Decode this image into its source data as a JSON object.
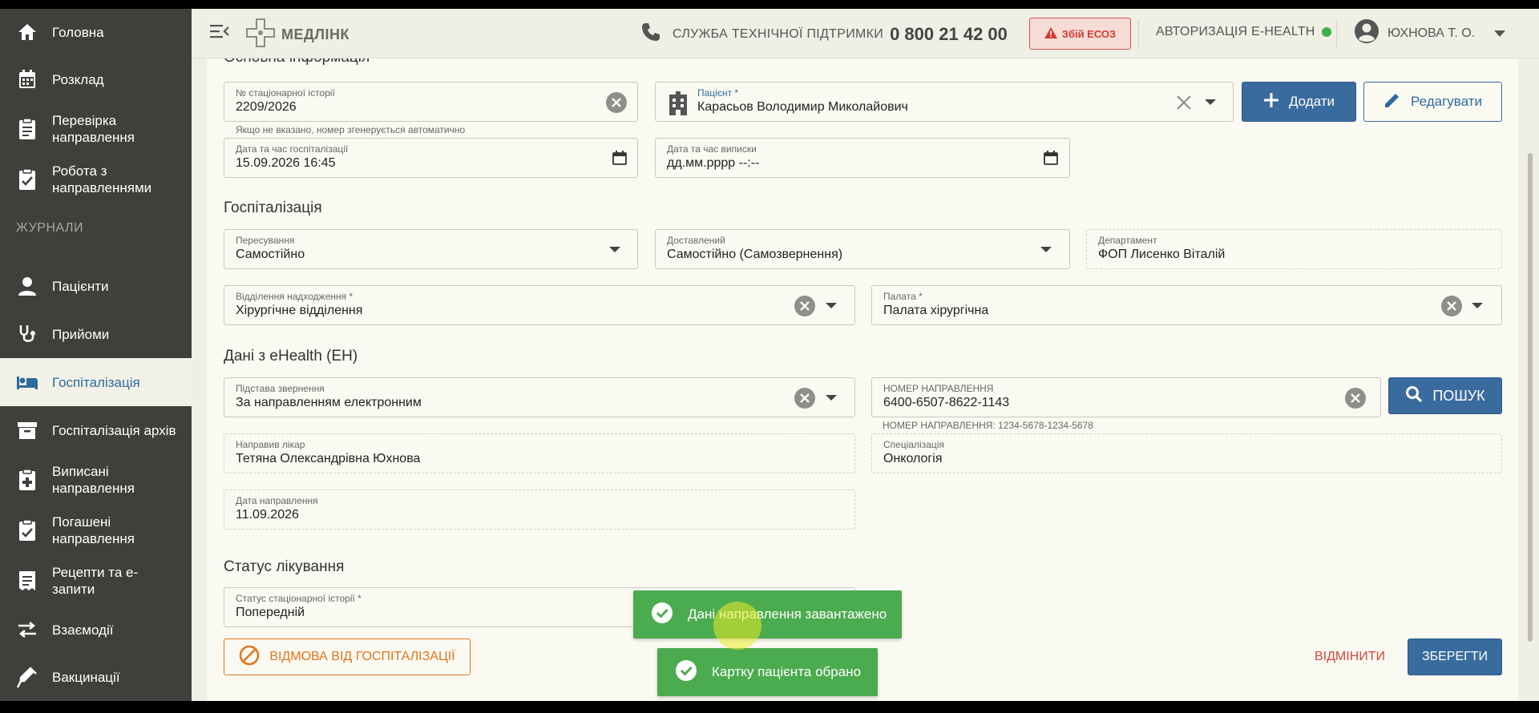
{
  "sidebar": {
    "items": [
      {
        "label": "Головна"
      },
      {
        "label": "Розклад"
      },
      {
        "label": "Перевірка\nнаправлення"
      },
      {
        "label": "Робота з\nнаправленнями"
      },
      {
        "label": "Пацієнти"
      },
      {
        "label": "Прийоми"
      },
      {
        "label": "Госпіталізація"
      },
      {
        "label": "Госпіталізація архів"
      },
      {
        "label": "Виписані\nнаправлення"
      },
      {
        "label": "Погашені\nнаправлення"
      },
      {
        "label": "Рецепти та е-\nзапити"
      },
      {
        "label": "Взаємодії"
      },
      {
        "label": "Вакцинації"
      }
    ],
    "section_label": "ЖУРНАЛИ"
  },
  "header": {
    "logo": "МЕДЛІНК",
    "support_label": "СЛУЖБА ТЕХНІЧНОЇ ПІДТРИМКИ",
    "support_phone": "0 800 21 42 00",
    "esoz_label": "Збій ЕСОЗ",
    "auth_label": "АВТОРИЗАЦІЯ E-HEALTH",
    "user_name": "ЮХНОВА Т. О."
  },
  "form": {
    "basic_title": "Основна інформація",
    "history_no": {
      "label": "№ стаціонарної історії",
      "value": "2209/2026",
      "hint": "Якщо не вказано, номер згенерується автоматично"
    },
    "patient": {
      "label": "Пацієнт *",
      "value": "Карасьов Володимир Миколайович"
    },
    "add_label": "Додати",
    "edit_label": "Редагувати",
    "admit_date": {
      "label": "Дата та час госпіталізації",
      "value": "15.09.2026 16:45"
    },
    "discharge_date": {
      "label": "Дата та час виписки",
      "value": "дд.мм.рррр --:--"
    },
    "hosp_title": "Госпіталізація",
    "transport": {
      "label": "Пересування",
      "value": "Самостійно"
    },
    "delivered": {
      "label": "Доставлений",
      "value": "Самостійно (Самозвернення)"
    },
    "department": {
      "label": "Департамент",
      "value": "ФОП Лисенко Віталій"
    },
    "ward_dept": {
      "label": "Відділення надходження *",
      "value": "Хірургічне відділення"
    },
    "ward": {
      "label": "Палата *",
      "value": "Палата хірургічна"
    },
    "eh_title": "Дані з eHealth (ЕН)",
    "reason": {
      "label": "Підстава звернення",
      "value": "За направленням електронним"
    },
    "referral_no": {
      "label": "НОМЕР НАПРАВЛЕННЯ",
      "value": "6400-6507-8622-1143",
      "hint": "НОМЕР НАПРАВЛЕННЯ: 1234-5678-1234-5678"
    },
    "search_label": "ПОШУК",
    "doctor": {
      "label": "Направив лікар",
      "value": "Тетяна Олександрівна Юхнова"
    },
    "specialization": {
      "label": "Спеціалізація",
      "value": "Онкологія"
    },
    "referral_date": {
      "label": "Дата направлення",
      "value": "11.09.2026"
    },
    "status_title": "Статус лікування",
    "status": {
      "label": "Статус стаціонарної історії *",
      "value": "Попередній"
    },
    "refuse_label": "ВІДМОВА ВІД ГОСПІТАЛІЗАЦІЇ",
    "cancel_label": "ВІДМІНИТИ",
    "save_label": "ЗБЕРЕГТИ"
  },
  "toasts": {
    "t1": "Дані направлення завантажено",
    "t2": "Картку пацієнта обрано"
  },
  "colors": {
    "sidebar": "#3f3f3b",
    "primary": "#3a6b9f",
    "success": "#4bab4f",
    "danger": "#d0463c",
    "warning": "#e0761e"
  }
}
